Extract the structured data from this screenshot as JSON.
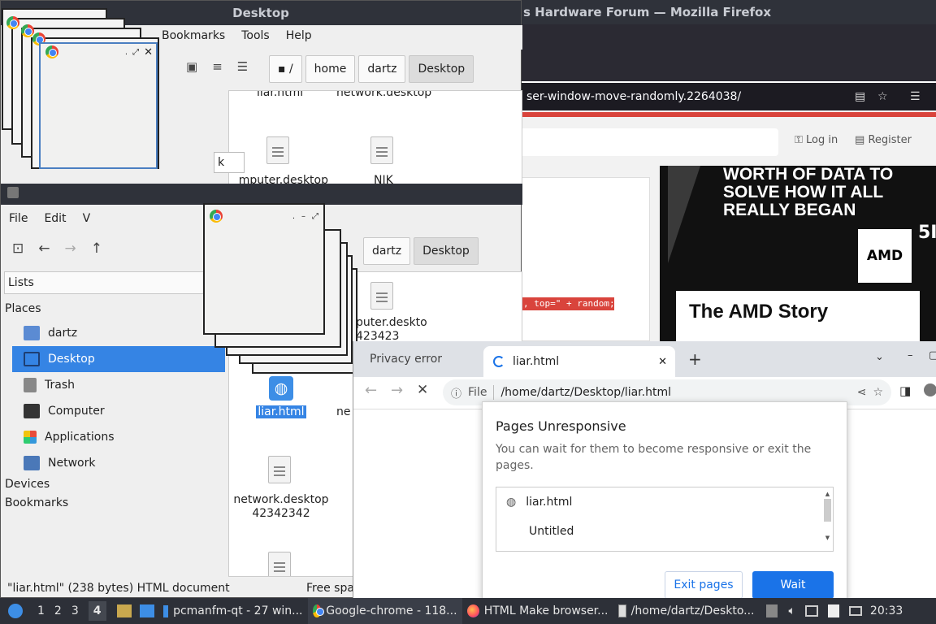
{
  "desktop_window": {
    "title": "Desktop",
    "menu": [
      "Bookmarks",
      "Tools",
      "Help"
    ],
    "path_root": "/",
    "breadcrumbs": [
      "home",
      "dartz",
      "Desktop"
    ],
    "files_top": [
      "liar.html",
      "network.desktop"
    ],
    "files_row2": [
      "computer.desktop",
      "NIK"
    ],
    "partial_text_k": "k"
  },
  "firefox": {
    "title": "s Hardware Forum — Mozilla Firefox",
    "url": "ser-window-move-randomly.2264038/",
    "login": "Log in",
    "register": "Register",
    "ad_text": "WORTH OF DATA TO SOLVE HOW IT ALL REALLY BEGAN",
    "ad_brand": "AMD",
    "ad_headline": "The AMD Story",
    "code_snippet": ", top=\" + random;",
    "partial_logo": "5I"
  },
  "filemanager": {
    "menu": [
      "File",
      "Edit",
      "V"
    ],
    "side_dropdown": "Lists",
    "places_header": "Places",
    "places": [
      {
        "label": "dartz",
        "icon": "folder-icon"
      },
      {
        "label": "Desktop",
        "icon": "desktop-icon"
      },
      {
        "label": "Trash",
        "icon": "trash-icon"
      },
      {
        "label": "Computer",
        "icon": "computer-icon"
      },
      {
        "label": "Applications",
        "icon": "applications-icon"
      },
      {
        "label": "Network",
        "icon": "network-icon"
      }
    ],
    "devices_header": "Devices",
    "bookmarks_header": "Bookmarks",
    "breadcrumbs": [
      "dartz",
      "Desktop"
    ],
    "files": [
      {
        "name": "puter.deskto",
        "sub": "423423"
      },
      {
        "name": "liar.html",
        "sub": ""
      },
      {
        "name": "ne",
        "sub": ""
      },
      {
        "name": "network.desktop",
        "sub": "42342342"
      }
    ],
    "status_left": "\"liar.html\" (238 bytes) HTML document",
    "status_right": "Free spa"
  },
  "chrome": {
    "tab_inactive": "Privacy error",
    "tab_active": "liar.html",
    "url_scheme": "File",
    "url": "/home/dartz/Desktop/liar.html"
  },
  "dialog": {
    "title": "Pages Unresponsive",
    "message": "You can wait for them to become responsive or exit the pages.",
    "pages": [
      "liar.html",
      "Untitled"
    ],
    "exit_label": "Exit pages",
    "wait_label": "Wait"
  },
  "taskbar": {
    "workspaces": [
      "1",
      "2",
      "3",
      "4"
    ],
    "active_workspace": "4",
    "tasks": [
      {
        "label": "pcmanfm-qt - 27 win...",
        "icon": "folder-icon"
      },
      {
        "label": "Google-chrome - 118...",
        "icon": "chrome-icon"
      },
      {
        "label": "HTML Make browser...",
        "icon": "firefox-icon"
      },
      {
        "label": "/home/dartz/Deskto...",
        "icon": "editor-icon"
      }
    ],
    "clock": "20:33"
  },
  "colors": {
    "accent": "#3d8ee6",
    "selection": "#3584e4",
    "titlebar": "#2f323a",
    "chrome_blue": "#1a73e8"
  }
}
